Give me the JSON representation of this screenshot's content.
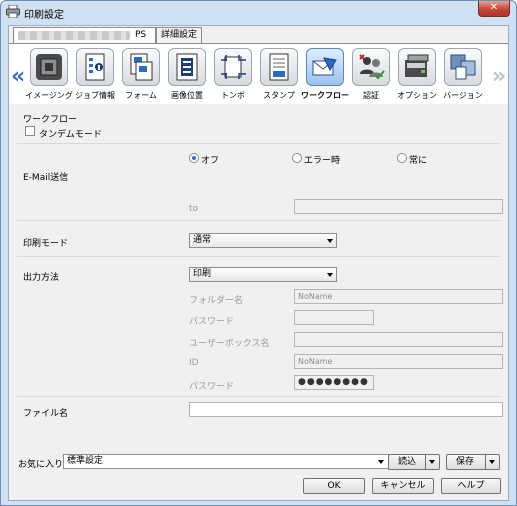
{
  "window": {
    "title": "印刷設定",
    "close_label": "✕"
  },
  "tabs": {
    "active_suffix": "PS",
    "second": "詳細設定"
  },
  "toolbar": {
    "items": [
      {
        "label": "イメージング",
        "icon": "imaging-icon"
      },
      {
        "label": "ジョブ情報",
        "icon": "job-info-icon"
      },
      {
        "label": "フォーム",
        "icon": "form-icon"
      },
      {
        "label": "画像位置",
        "icon": "image-position-icon"
      },
      {
        "label": "トンボ",
        "icon": "crop-marks-icon"
      },
      {
        "label": "スタンプ",
        "icon": "stamp-icon"
      },
      {
        "label": "ワークフロー",
        "icon": "workflow-icon",
        "selected": true
      },
      {
        "label": "認証",
        "icon": "authentication-icon"
      },
      {
        "label": "オプション",
        "icon": "options-icon"
      },
      {
        "label": "バージョン",
        "icon": "version-icon"
      }
    ]
  },
  "workflow": {
    "section_title": "ワークフロー",
    "tandem_label": "タンデムモード",
    "tandem_checked": false
  },
  "email": {
    "label": "E-Mail送信",
    "options": [
      "オフ",
      "エラー時",
      "常に"
    ],
    "selected": "オフ",
    "to_label": "to",
    "to_value": ""
  },
  "print_mode": {
    "label": "印刷モード",
    "value": "通常"
  },
  "output": {
    "label": "出力方法",
    "value": "印刷",
    "folder_label": "フォルダー名",
    "folder_value": "NoName",
    "password_label": "パスワード",
    "password_value": "",
    "userbox_label": "ユーザーボックス名",
    "userbox_value": "",
    "id_label": "ID",
    "id_value": "NoName",
    "password2_label": "パスワード",
    "password2_value": "●●●●●●●●"
  },
  "filename": {
    "label": "ファイル名",
    "value": ""
  },
  "favorites": {
    "label": "お気に入り",
    "value": "標準設定",
    "load_label": "読込",
    "save_label": "保存"
  },
  "buttons": {
    "ok": "OK",
    "cancel": "キャンセル",
    "help": "ヘルプ"
  }
}
